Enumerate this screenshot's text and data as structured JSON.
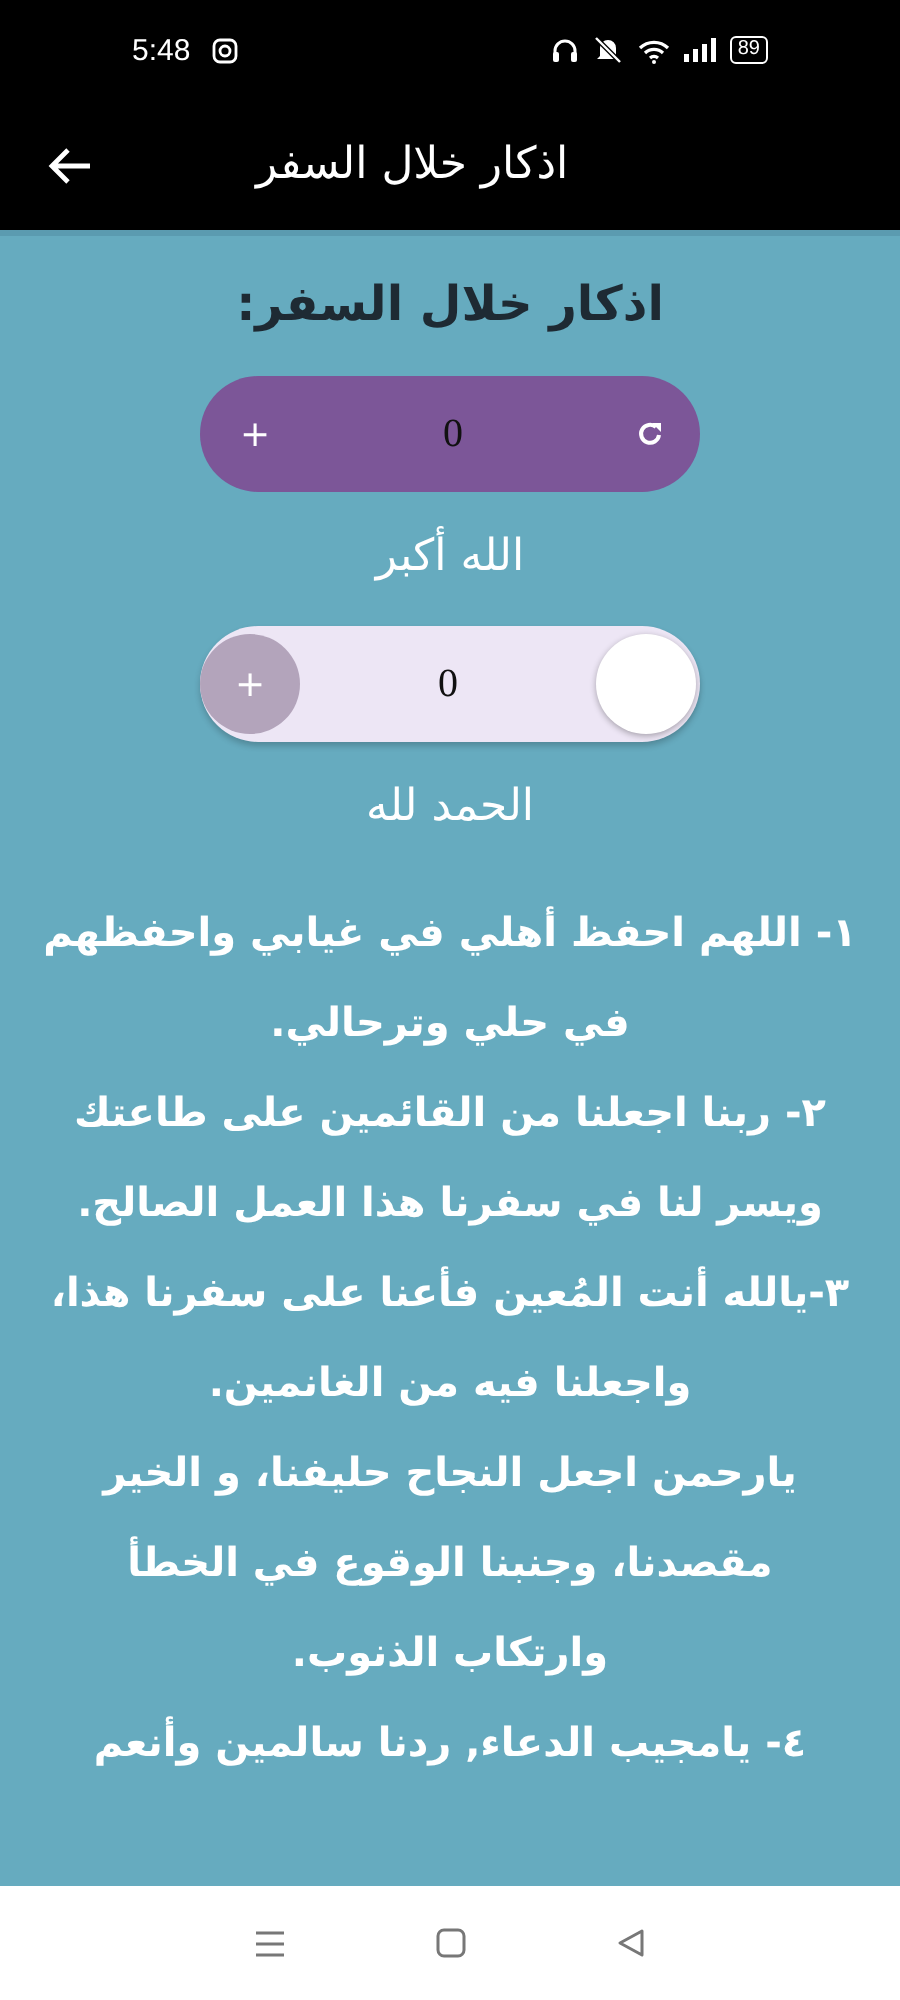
{
  "status_bar": {
    "time": "5:48",
    "battery": "89"
  },
  "app_bar": {
    "title": "اذكار خلال السفر"
  },
  "heading": "اذكار خلال السفر:",
  "items": [
    {
      "kind": "button",
      "plus": "+",
      "value": "0"
    },
    {
      "kind": "label",
      "text": "الله أكبر"
    },
    {
      "kind": "slider",
      "plus": "+",
      "value": "0"
    },
    {
      "kind": "label",
      "text": "الحمد لله"
    }
  ],
  "lines": [
    "١- اللهم احفظ أهلي في غيابي واحفظهم",
    "في حلي وترحالي.",
    "٢- ربنا اجعلنا من القائمين على طاعتك",
    "ويسر لنا في سفرنا هذا العمل الصالح.",
    "٣-يالله أنت المُعين فأعنا على سفرنا هذا،",
    "واجعلنا فيه من الغانمين.",
    "يارحمن اجعل النجاح حليفنا، و الخير",
    "مقصدنا، وجنبنا الوقوع في الخطأ",
    "وارتكاب الذنوب.",
    "٤- يامجيب الدعاء, ردنا سالمين وأنعم"
  ]
}
